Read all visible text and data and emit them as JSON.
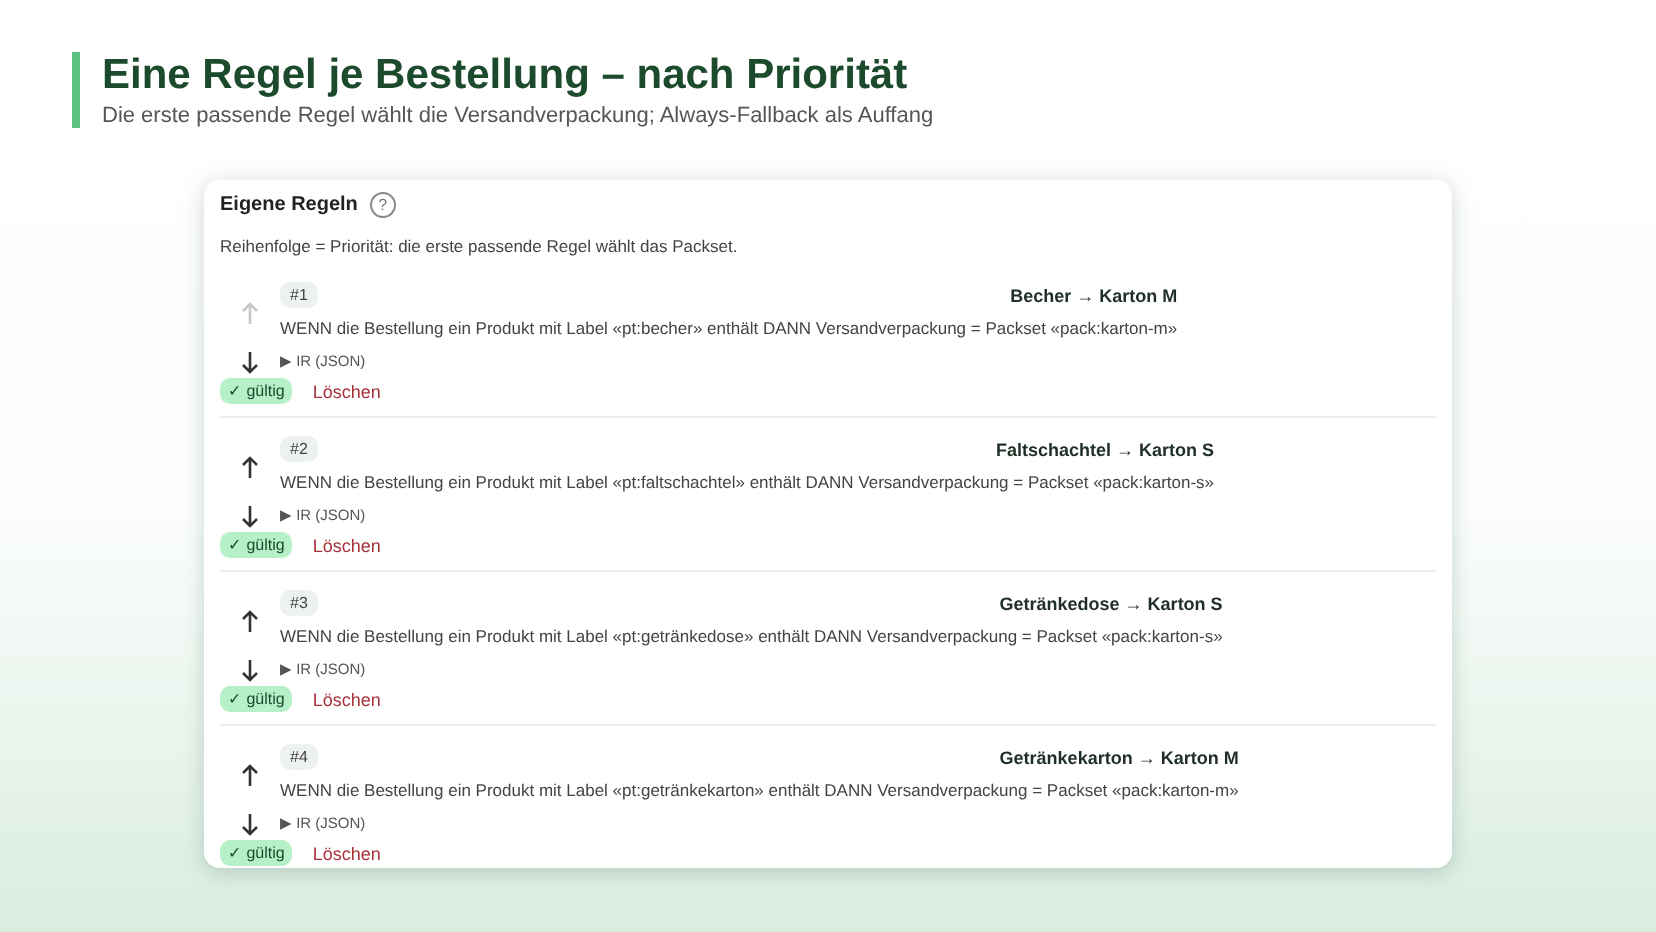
{
  "header": {
    "title": "Eine Regel je Bestellung – nach Priorität",
    "subtitle": "Die erste passende Regel wählt die Versandverpackung; Always-Fallback als Auffang"
  },
  "panel": {
    "title": "Eigene Regeln",
    "help_icon": "?",
    "description": "Reihenfolge = Priorität: die erste passende Regel wählt das Packset.",
    "rules": [
      {
        "number": "#1",
        "name": "Becher → Karton M",
        "text": "WENN die Bestellung ein Produkt mit Label «pt:becher» enthält DANN Versandverpackung = Packset «pack:karton-m»",
        "ir": "▶ IR (JSON)",
        "status": "✓ gültig",
        "valid": true,
        "delete": "Löschen",
        "up_disabled": true,
        "down_disabled": false
      },
      {
        "number": "#2",
        "name": "Faltschachtel → Karton S",
        "text": "WENN die Bestellung ein Produkt mit Label «pt:faltschachtel» enthält DANN Versandverpackung = Packset «pack:karton-s»",
        "ir": "▶ IR (JSON)",
        "status": "✓ gültig",
        "valid": true,
        "delete": "Löschen",
        "up_disabled": false,
        "down_disabled": false
      },
      {
        "number": "#3",
        "name": "Getränkedose → Karton S",
        "text": "WENN die Bestellung ein Produkt mit Label «pt:getränkedose» enthält DANN Versandverpackung = Packset «pack:karton-s»",
        "ir": "▶ IR (JSON)",
        "status": "✓ gültig",
        "valid": true,
        "delete": "Löschen",
        "up_disabled": false,
        "down_disabled": false
      },
      {
        "number": "#4",
        "name": "Getränkekarton → Karton M",
        "text": "WENN die Bestellung ein Produkt mit Label «pt:getränkekarton» enthält DANN Versandverpackung = Packset «pack:karton-m»",
        "ir": "▶ IR (JSON)",
        "status": "✓ gültig",
        "valid": true,
        "delete": "Löschen",
        "up_disabled": false,
        "down_disabled": false
      }
    ]
  }
}
